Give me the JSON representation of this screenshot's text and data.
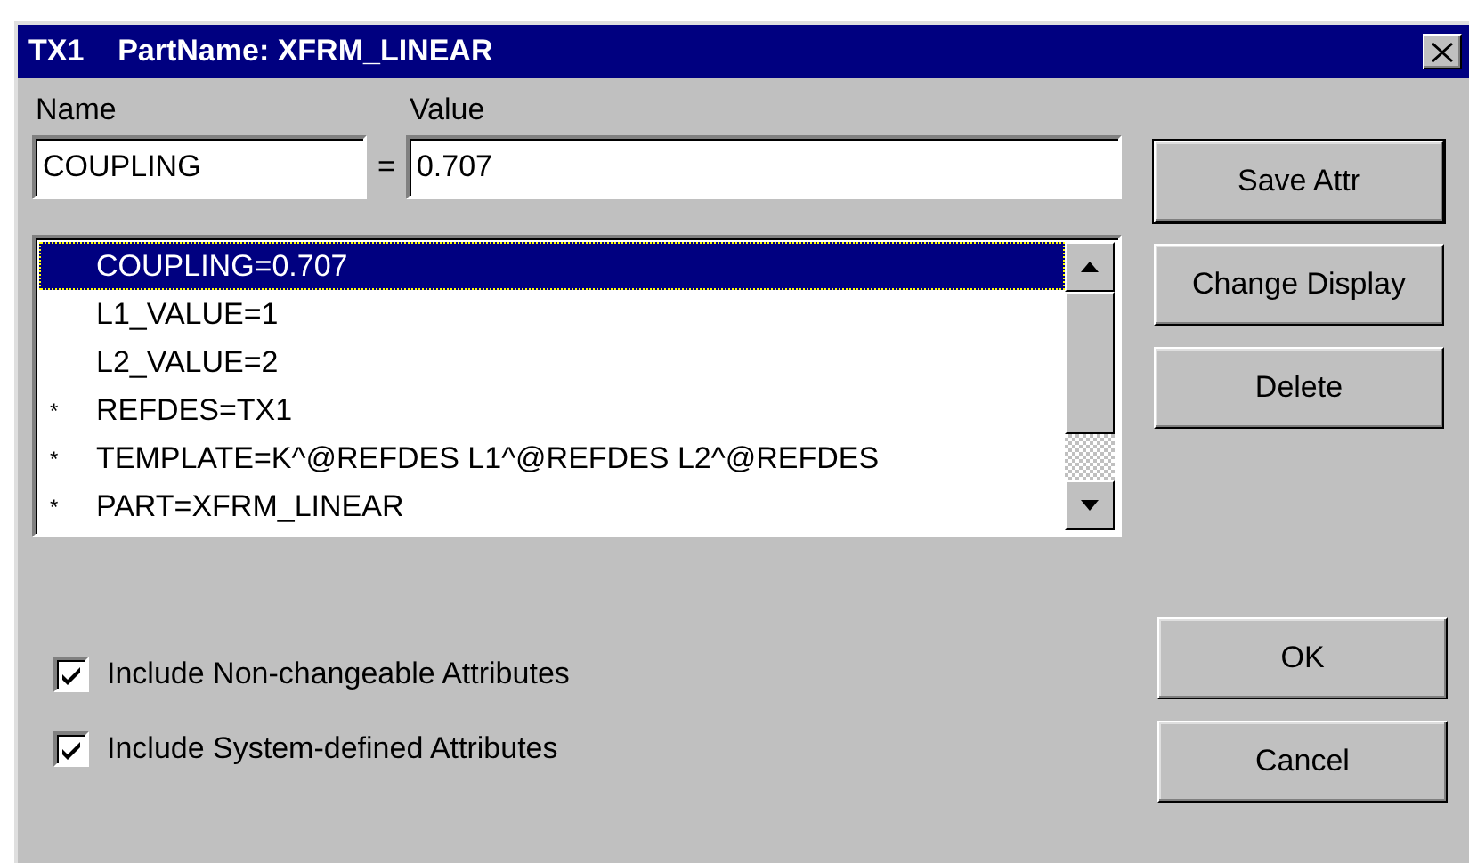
{
  "window": {
    "title": "TX1    PartName: XFRM_LINEAR"
  },
  "name_field": {
    "label": "Name",
    "value": "COUPLING"
  },
  "equals": "=",
  "value_field": {
    "label": "Value",
    "value": "0.707"
  },
  "attributes": [
    {
      "text": "COUPLING=0.707",
      "selected": true
    },
    {
      "text": "L1_VALUE=1",
      "selected": false
    },
    {
      "text": "L2_VALUE=2",
      "selected": false
    },
    {
      "marker": "*",
      "text": "REFDES=TX1",
      "selected": false
    },
    {
      "marker": "*",
      "text": "TEMPLATE=K^@REFDES L1^@REFDES L2^@REFDES",
      "selected": false
    },
    {
      "marker": "*",
      "text": "PART=XFRM_LINEAR",
      "selected": false
    }
  ],
  "side_buttons": [
    {
      "label": "Save Attr",
      "default": true
    },
    {
      "label": "Change Display",
      "default": false
    },
    {
      "label": "Delete",
      "default": false
    }
  ],
  "options": [
    {
      "label": "Include Non-changeable Attributes",
      "checked": true
    },
    {
      "label": "Include System-defined Attributes",
      "checked": true
    }
  ],
  "dialog_buttons": [
    {
      "label": "OK"
    },
    {
      "label": "Cancel"
    }
  ]
}
